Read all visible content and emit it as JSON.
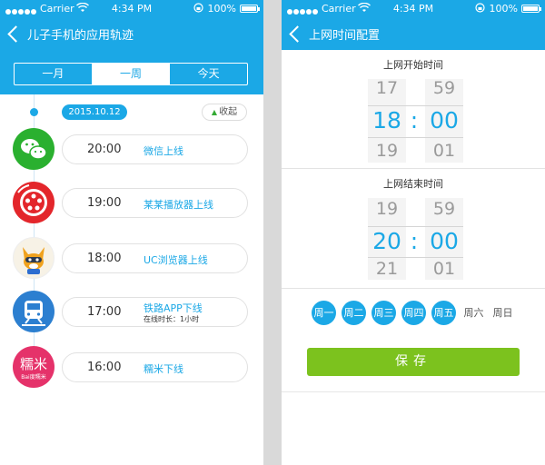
{
  "status_bar": {
    "carrier": "Carrier",
    "time": "4:34 PM",
    "battery": "100%"
  },
  "left_screen": {
    "title": "儿子手机的应用轨迹",
    "tabs": [
      {
        "label": "一月",
        "active": false
      },
      {
        "label": "一周",
        "active": true
      },
      {
        "label": "今天",
        "active": false
      }
    ],
    "date": "2015.10.12",
    "collapse_label": "收起",
    "entries": [
      {
        "time": "20:00",
        "label": "微信上线",
        "sub": "",
        "icon": "wechat-icon"
      },
      {
        "time": "19:00",
        "label": "某某播放器上线",
        "sub": "",
        "icon": "video-player-icon"
      },
      {
        "time": "18:00",
        "label": "UC浏览器上线",
        "sub": "",
        "icon": "uc-browser-icon"
      },
      {
        "time": "17:00",
        "label": "铁路APP下线",
        "sub": "在线时长：1小时",
        "icon": "railway-app-icon"
      },
      {
        "time": "16:00",
        "label": "糯米下线",
        "sub": "",
        "icon": "nuomi-icon"
      }
    ],
    "icon_text": {
      "nuomi_main": "糯米",
      "nuomi_brand": "Bai度糯米"
    }
  },
  "right_screen": {
    "title": "上网时间配置",
    "start": {
      "label": "上网开始时间",
      "hour_prev": "17",
      "hour": "18",
      "hour_next": "19",
      "minute_prev": "59",
      "minute": "00",
      "minute_next": "01"
    },
    "end": {
      "label": "上网结束时间",
      "hour_prev": "19",
      "hour": "20",
      "hour_next": "21",
      "minute_prev": "59",
      "minute": "00",
      "minute_next": "01"
    },
    "colon": ":",
    "days": [
      {
        "label": "周一",
        "selected": true
      },
      {
        "label": "周二",
        "selected": true
      },
      {
        "label": "周三",
        "selected": true
      },
      {
        "label": "周四",
        "selected": true
      },
      {
        "label": "周五",
        "selected": true
      },
      {
        "label": "周六",
        "selected": false
      },
      {
        "label": "周日",
        "selected": false
      }
    ],
    "save_label": "保存"
  },
  "colors": {
    "accent": "#1ba8e6",
    "save_green": "#7cc21e"
  }
}
